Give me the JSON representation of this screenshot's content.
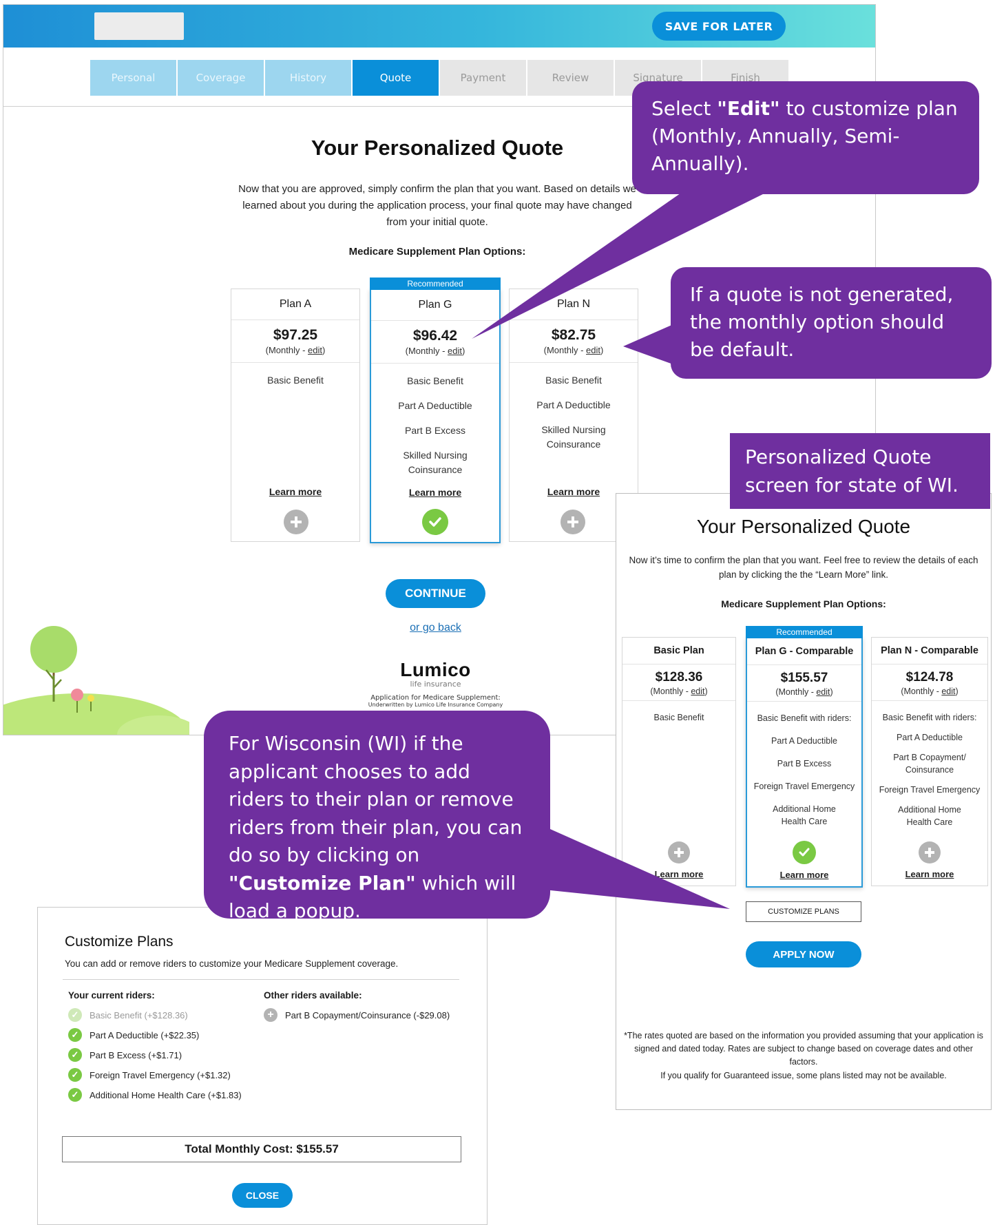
{
  "header": {
    "save_label": "SAVE FOR LATER"
  },
  "steps": [
    "Personal",
    "Coverage",
    "History",
    "Quote",
    "Payment",
    "Review",
    "Signature",
    "Finish"
  ],
  "main": {
    "title": "Your Personalized Quote",
    "intro": "Now that you are approved, simply confirm the plan that you want. Based on details we learned about you during the application process, your final quote may have changed from your initial quote.",
    "options_heading": "Medicare Supplement Plan Options:",
    "recommended_label": "Recommended",
    "plans": [
      {
        "name": "Plan A",
        "price": "$97.25",
        "freq_prefix": "(Monthly - ",
        "edit": "edit",
        "freq_suffix": ")",
        "features": [
          "Basic Benefit"
        ],
        "learn": "Learn more"
      },
      {
        "name": "Plan G",
        "price": "$96.42",
        "freq_prefix": "(Monthly - ",
        "edit": "edit",
        "freq_suffix": ")",
        "features": [
          "Basic Benefit",
          "Part A Deductible",
          "Part B Excess",
          "Skilled Nursing Coinsurance"
        ],
        "learn": "Learn more"
      },
      {
        "name": "Plan N",
        "price": "$82.75",
        "freq_prefix": "(Monthly - ",
        "edit": "edit",
        "freq_suffix": ")",
        "features": [
          "Basic Benefit",
          "Part A Deductible",
          "Skilled Nursing Coinsurance"
        ],
        "learn": "Learn more"
      }
    ],
    "continue_label": "CONTINUE",
    "go_back_label": "or go back",
    "brand": "Lumico",
    "brand_sub": "life insurance",
    "brand_app": "Application for Medicare Supplement:",
    "brand_underwriter": "Underwritten by Lumico Life Insurance Company"
  },
  "wi": {
    "title": "Your Personalized Quote",
    "intro": "Now it’s time to confirm the plan that you want. Feel free to review the details of each plan by clicking the the “Learn More” link.",
    "options_heading": "Medicare Supplement Plan Options:",
    "recommended_label": "Recommended",
    "plans": [
      {
        "name": "Basic Plan",
        "price": "$128.36",
        "freq_prefix": "(Monthly - ",
        "edit": "edit",
        "freq_suffix": ")",
        "features": [
          "Basic Benefit"
        ],
        "learn": "Learn more"
      },
      {
        "name": "Plan G - Comparable",
        "price": "$155.57",
        "freq_prefix": "(Monthly - ",
        "edit": "edit",
        "freq_suffix": ")",
        "features": [
          "Basic Benefit with riders:",
          "Part A Deductible",
          "Part B Excess",
          "Foreign Travel Emergency",
          "Additional Home Health Care"
        ],
        "learn": "Learn more"
      },
      {
        "name": "Plan N - Comparable",
        "price": "$124.78",
        "freq_prefix": "(Monthly - ",
        "edit": "edit",
        "freq_suffix": ")",
        "features": [
          "Basic Benefit with riders:",
          "Part A Deductible",
          "Part B Copayment/ Coinsurance",
          "Foreign Travel Emergency",
          "Additional Home Health Care"
        ],
        "learn": "Learn more"
      }
    ],
    "customize_label": "CUSTOMIZE PLANS",
    "apply_label": "APPLY NOW",
    "disclaimer": "*The rates quoted are based on the information you provided assuming that your application is signed and dated today. Rates are subject to change based on coverage dates and other factors.",
    "guaranteed_note": "If you qualify for Guaranteed issue, some plans listed may not be available."
  },
  "popup": {
    "title": "Customize Plans",
    "description": "You can add or remove riders to customize your Medicare Supplement coverage.",
    "current_heading": "Your current riders:",
    "other_heading": "Other riders available:",
    "current_riders": [
      "Basic Benefit (+$128.36)",
      "Part A Deductible (+$22.35)",
      "Part B Excess (+$1.71)",
      "Foreign Travel Emergency (+$1.32)",
      "Additional Home Health Care (+$1.83)"
    ],
    "other_riders": [
      "Part B Copayment/Coinsurance (-$29.08)"
    ],
    "total_label": "Total Monthly Cost: $155.57",
    "close_label": "CLOSE"
  },
  "callouts": {
    "edit_pre": "Select ",
    "edit_bold": "\"Edit\"",
    "edit_post": " to customize plan (Monthly, Annually, Semi-Annually).",
    "default_note": "If a quote is not generated, the monthly option should be default.",
    "wi_screen_note": "Personalized Quote screen for state of WI.",
    "wi_pre": "For Wisconsin (WI) if the applicant chooses to add riders to their plan or remove riders from their plan, you can do so by clicking on ",
    "wi_bold": "\"Customize Plan\"",
    "wi_post": " which will load a popup."
  },
  "colors": {
    "brand_blue": "#0a8fd9",
    "callout_purple": "#6f2f9f",
    "check_green": "#7ac943",
    "plus_gray": "#b3b3b3"
  }
}
